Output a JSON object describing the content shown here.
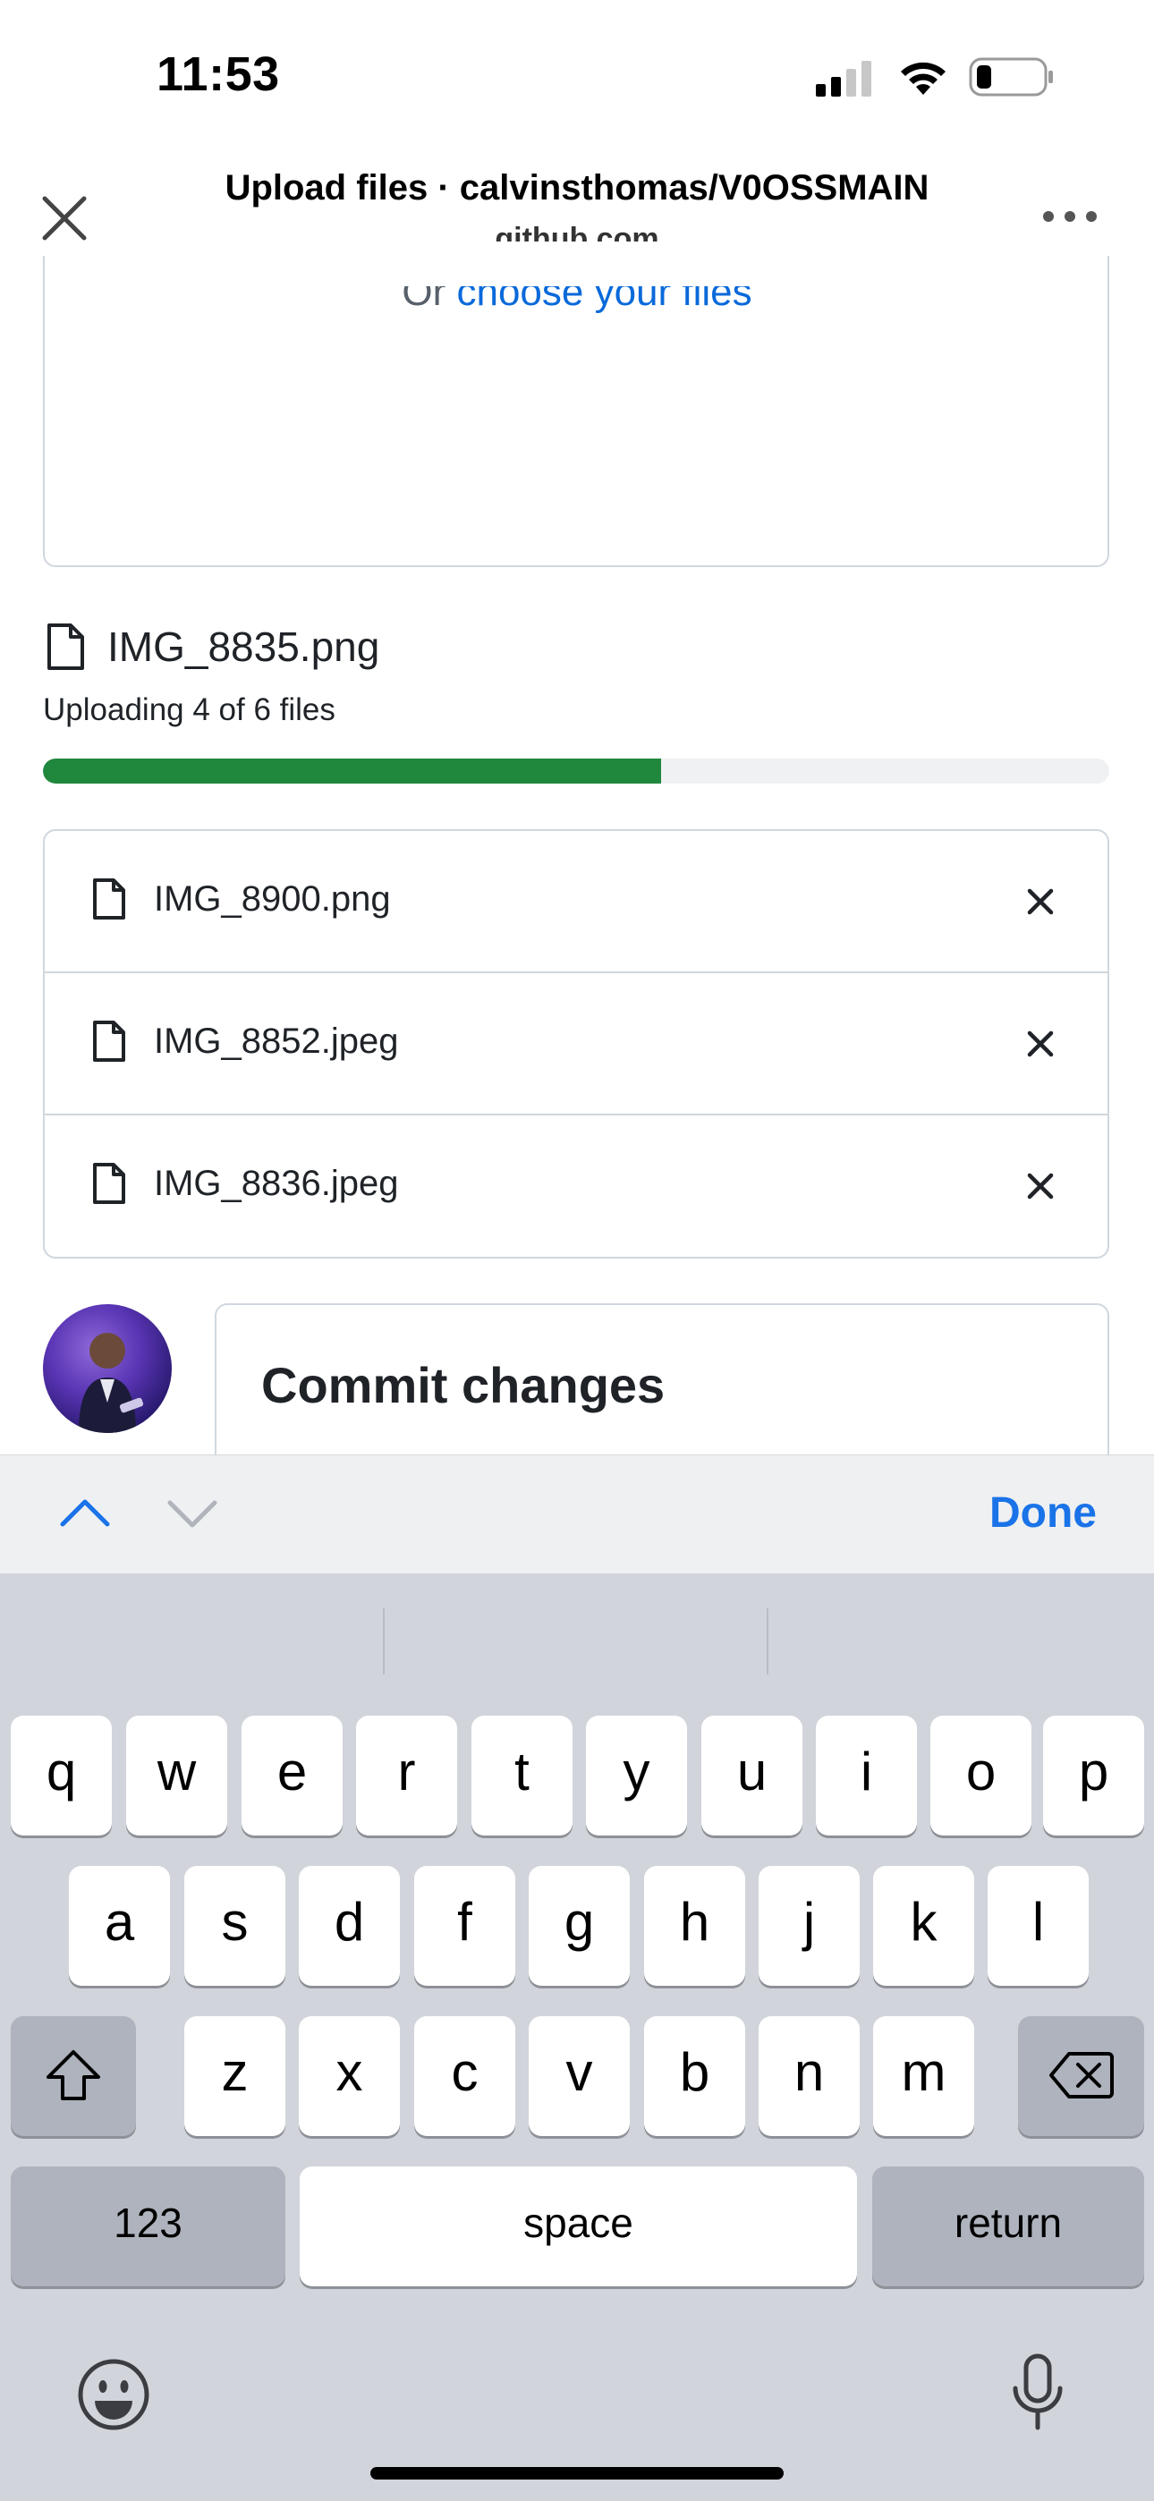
{
  "status_bar": {
    "time": "11:53"
  },
  "browser": {
    "title": "Upload files · calvinsthomas/V0OSSMAIN",
    "domain": "github.com"
  },
  "upload": {
    "drop_prefix": "Or ",
    "drop_link": "choose your files",
    "current_file": "IMG_8835.png",
    "status": "Uploading 4 of 6 files",
    "progress_fraction": 0.58
  },
  "files": [
    {
      "name": "IMG_8900.png"
    },
    {
      "name": "IMG_8852.jpeg"
    },
    {
      "name": "IMG_8836.jpeg"
    }
  ],
  "commit": {
    "title": "Commit changes"
  },
  "keyboard_toolbar": {
    "done_label": "Done"
  },
  "keyboard": {
    "row1": [
      "q",
      "w",
      "e",
      "r",
      "t",
      "y",
      "u",
      "i",
      "o",
      "p"
    ],
    "row2": [
      "a",
      "s",
      "d",
      "f",
      "g",
      "h",
      "j",
      "k",
      "l"
    ],
    "row3": [
      "z",
      "x",
      "c",
      "v",
      "b",
      "n",
      "m"
    ],
    "numbers_label": "123",
    "space_label": "space",
    "return_label": "return"
  },
  "colors": {
    "progress": "#1f883d",
    "link": "#0969da",
    "done": "#1a73e8"
  }
}
